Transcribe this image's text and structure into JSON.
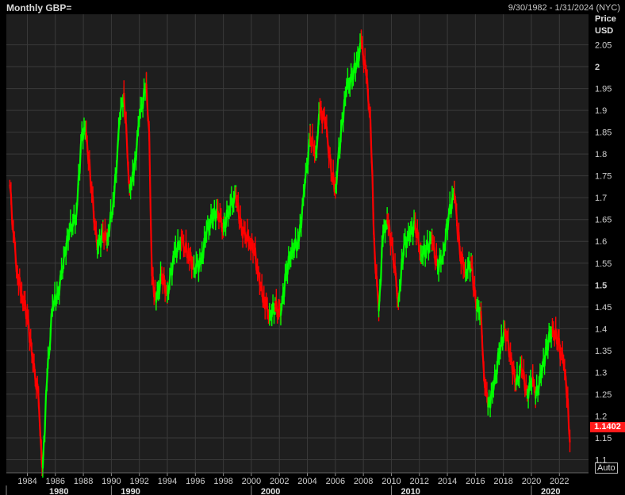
{
  "header": {
    "title": "Monthly GBP=",
    "date_range": "9/30/1982 - 1/31/2024 (NYC)"
  },
  "axis": {
    "price_label": "Price",
    "currency_label": "USD",
    "auto_label": "Auto"
  },
  "last_price": "1.1402",
  "colors": {
    "up": "#00ff00",
    "down": "#ff0000",
    "background": "#1e1e1e",
    "grid": "#3a3a3a",
    "last_price_tag": "#ff1a1a"
  },
  "chart_data": {
    "type": "line",
    "series": [
      {
        "name": "GBP=",
        "x": [
          1982.75,
          1983.0,
          1983.3,
          1983.6,
          1984.0,
          1984.4,
          1984.8,
          1985.0,
          1985.1,
          1985.4,
          1985.8,
          1986.2,
          1986.6,
          1987.0,
          1987.5,
          1987.9,
          1988.2,
          1988.6,
          1989.0,
          1989.4,
          1989.7,
          1990.2,
          1990.6,
          1990.9,
          1991.3,
          1991.6,
          1992.0,
          1992.5,
          1992.7,
          1992.9,
          1993.2,
          1993.6,
          1994.0,
          1994.5,
          1995.0,
          1995.5,
          1995.9,
          1996.4,
          1996.8,
          1997.2,
          1997.6,
          1998.0,
          1998.5,
          1998.9,
          1999.3,
          1999.8,
          2000.2,
          2000.6,
          2000.9,
          2001.3,
          2001.7,
          2002.1,
          2002.5,
          2002.9,
          2003.4,
          2003.8,
          2004.2,
          2004.6,
          2004.9,
          2005.3,
          2005.7,
          2006.0,
          2006.4,
          2006.8,
          2007.2,
          2007.6,
          2007.85,
          2008.2,
          2008.5,
          2008.8,
          2009.1,
          2009.4,
          2009.7,
          2010.1,
          2010.5,
          2010.9,
          2011.3,
          2011.7,
          2012.1,
          2012.5,
          2012.9,
          2013.3,
          2013.7,
          2014.1,
          2014.5,
          2014.9,
          2015.3,
          2015.7,
          2016.1,
          2016.4,
          2016.6,
          2016.9,
          2017.3,
          2017.7,
          2018.1,
          2018.5,
          2018.9,
          2019.3,
          2019.7,
          2020.1,
          2020.3,
          2020.7,
          2021.1,
          2021.5,
          2021.9,
          2022.3,
          2022.6,
          2022.75
        ],
        "values": [
          1.73,
          1.62,
          1.52,
          1.48,
          1.43,
          1.32,
          1.24,
          1.12,
          1.08,
          1.28,
          1.45,
          1.48,
          1.56,
          1.62,
          1.66,
          1.85,
          1.85,
          1.71,
          1.58,
          1.62,
          1.6,
          1.7,
          1.88,
          1.94,
          1.72,
          1.75,
          1.88,
          1.96,
          1.85,
          1.52,
          1.46,
          1.52,
          1.48,
          1.57,
          1.6,
          1.57,
          1.54,
          1.55,
          1.62,
          1.65,
          1.67,
          1.63,
          1.68,
          1.7,
          1.63,
          1.6,
          1.58,
          1.5,
          1.47,
          1.43,
          1.45,
          1.43,
          1.53,
          1.58,
          1.6,
          1.72,
          1.84,
          1.8,
          1.9,
          1.87,
          1.76,
          1.72,
          1.85,
          1.95,
          1.97,
          2.02,
          2.06,
          1.98,
          1.88,
          1.58,
          1.44,
          1.61,
          1.65,
          1.58,
          1.46,
          1.59,
          1.61,
          1.64,
          1.57,
          1.58,
          1.6,
          1.54,
          1.57,
          1.66,
          1.71,
          1.57,
          1.53,
          1.55,
          1.44,
          1.44,
          1.3,
          1.22,
          1.26,
          1.34,
          1.4,
          1.34,
          1.27,
          1.31,
          1.25,
          1.29,
          1.24,
          1.29,
          1.36,
          1.4,
          1.37,
          1.32,
          1.24,
          1.14
        ]
      }
    ],
    "xlim": [
      1982.5,
      2024.08
    ],
    "ylim": [
      1.07,
      2.12
    ],
    "y_ticks": [
      "1.1",
      "1.15",
      "1.2",
      "1.25",
      "1.3",
      "1.35",
      "1.4",
      "1.45",
      "1.5",
      "1.55",
      "1.6",
      "1.65",
      "1.7",
      "1.75",
      "1.8",
      "1.85",
      "1.9",
      "1.95",
      "2",
      "2.05"
    ],
    "y_ticks_bold": [
      "1.5",
      "2"
    ],
    "x_ticks": [
      "1984",
      "1986",
      "1988",
      "1990",
      "1992",
      "1994",
      "1996",
      "1998",
      "2000",
      "2002",
      "2004",
      "2006",
      "2008",
      "2010",
      "2012",
      "2014",
      "2016",
      "2018",
      "2020",
      "2022"
    ],
    "x_major": [
      "1980",
      "1990",
      "2000",
      "2010",
      "2020"
    ],
    "grid": true
  }
}
